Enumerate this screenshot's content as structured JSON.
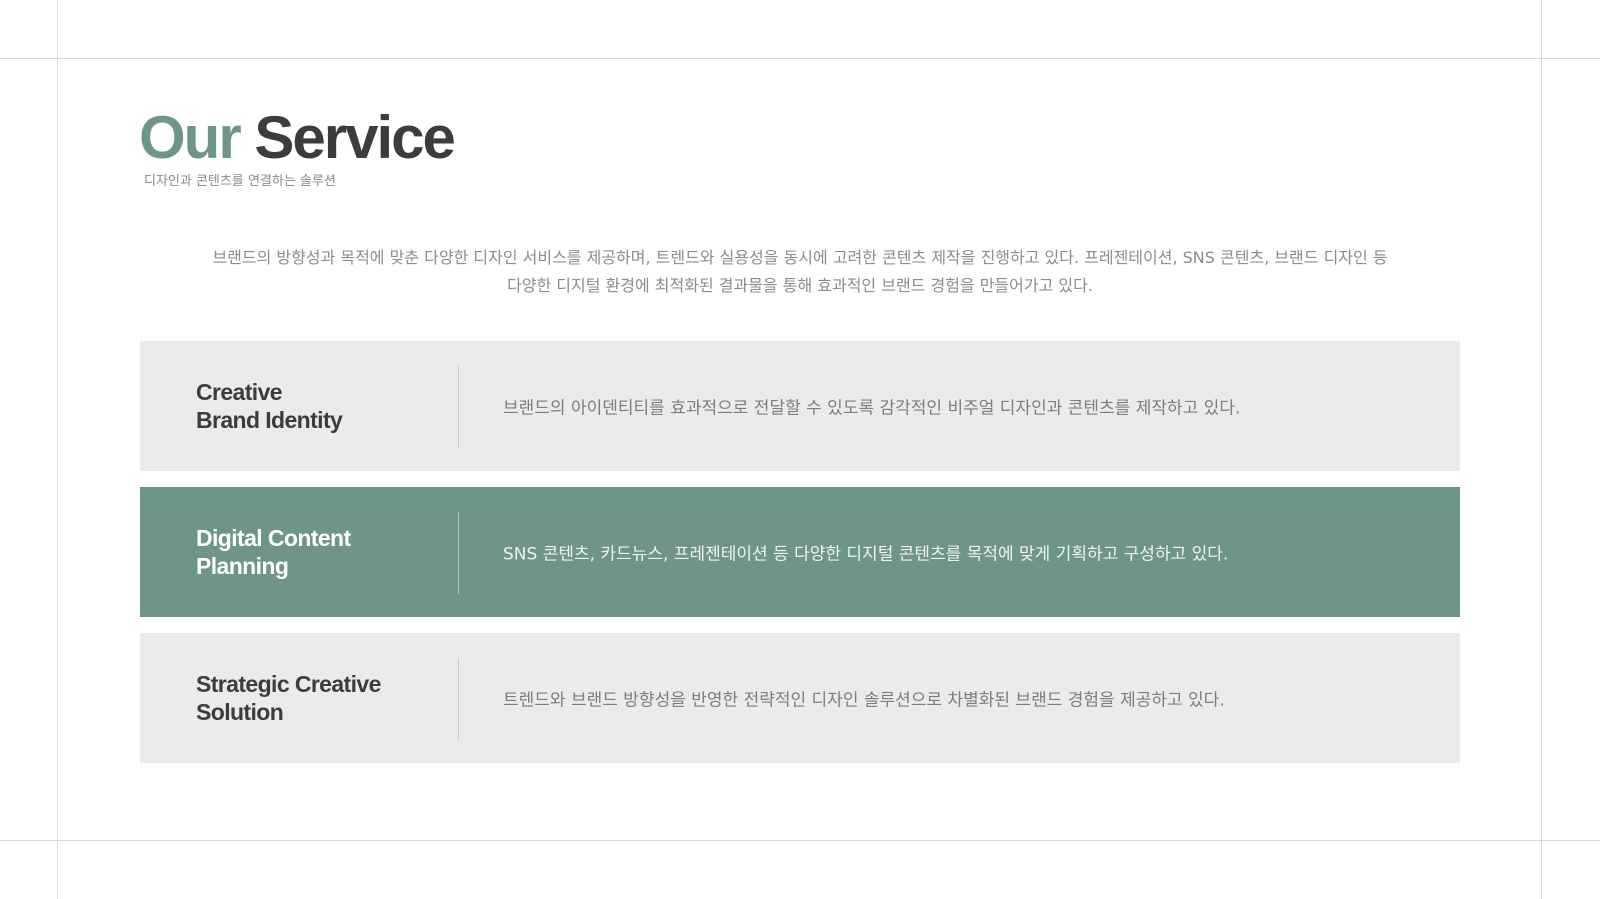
{
  "header": {
    "title_accent": "Our",
    "title_main": "Service",
    "subtitle": "디자인과 콘텐츠를 연결하는 솔루션"
  },
  "intro": {
    "line1": "브랜드의 방향성과 목적에 맞춘 다양한 디자인 서비스를 제공하며, 트렌드와 실용성을 동시에 고려한 콘텐츠 제작을 진행하고 있다. 프레젠테이션, SNS 콘텐츠, 브랜드 디자인 등",
    "line2": "다양한 디지털 환경에 최적화된 결과물을 통해 효과적인 브랜드 경험을 만들어가고 있다."
  },
  "services": [
    {
      "title_line1": "Creative",
      "title_line2": "Brand Identity",
      "description": "브랜드의 아이덴티티를 효과적으로 전달할 수 있도록 감각적인 비주얼 디자인과 콘텐츠를 제작하고 있다.",
      "highlighted": false
    },
    {
      "title_line1": "Digital Content",
      "title_line2": "Planning",
      "description": "SNS 콘텐츠, 카드뉴스, 프레젠테이션 등 다양한 디지털 콘텐츠를 목적에 맞게 기획하고 구성하고 있다.",
      "highlighted": true
    },
    {
      "title_line1": "Strategic Creative",
      "title_line2": "Solution",
      "description": "트렌드와 브랜드 방향성을 반영한 전략적인 디자인 솔루션으로 차별화된 브랜드 경험을 제공하고 있다.",
      "highlighted": false
    }
  ],
  "colors": {
    "accent": "#6e9585",
    "title_dark": "#3a3d3c",
    "card_bg": "#ebebeb",
    "body_text": "#8c8c8c"
  }
}
